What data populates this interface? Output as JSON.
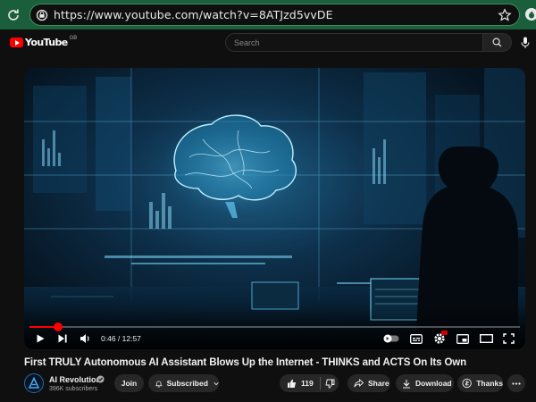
{
  "browser": {
    "url": "https://www.youtube.com/watch?v=8ATJzd5vvDE"
  },
  "header": {
    "logo_text": "YouTube",
    "region": "GB",
    "search_placeholder": "Search"
  },
  "player": {
    "current_time": "0:46",
    "duration": "12:57",
    "time_display": "0:46 / 12:57",
    "progress_fraction": 0.059
  },
  "video": {
    "title": "First TRULY Autonomous AI Assistant Blows Up the Internet - THINKS and ACTS On Its Own"
  },
  "channel": {
    "name": "AI Revolution",
    "subscribers": "396K subscribers",
    "verified": true
  },
  "actions": {
    "join_label": "Join",
    "subscribed_label": "Subscribed",
    "like_count": "119",
    "share_label": "Share",
    "download_label": "Download",
    "thanks_label": "Thanks"
  },
  "colors": {
    "browser_bar": "#1b5e3b",
    "brand_red": "#ff0000",
    "page_bg": "#0f0f0f",
    "pill_bg": "#272727"
  }
}
